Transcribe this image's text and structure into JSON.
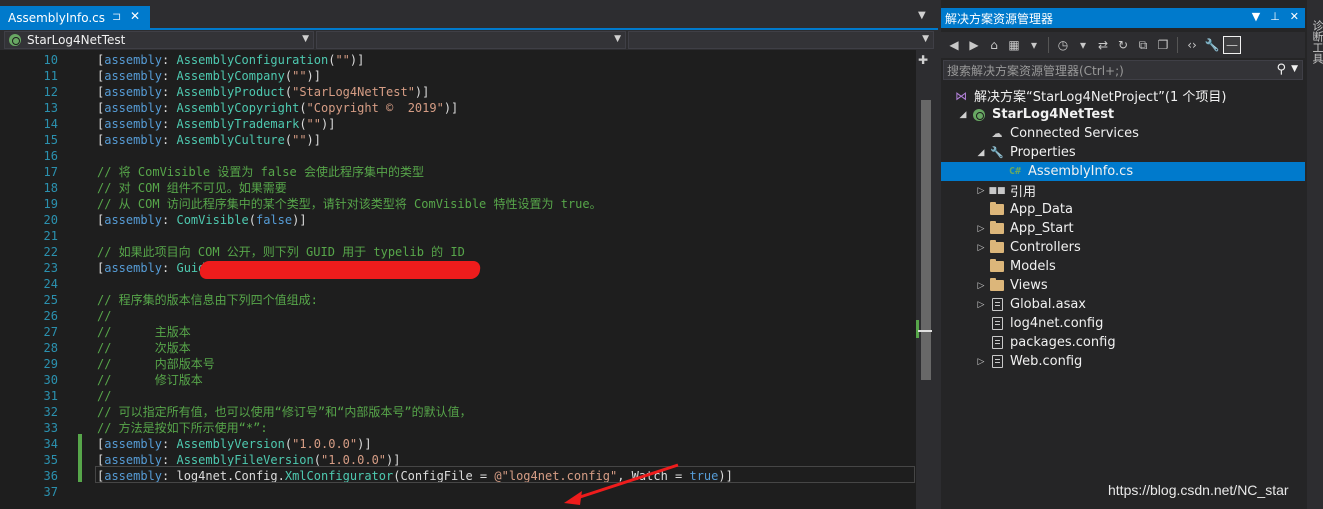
{
  "editor": {
    "tab": {
      "title": "AssemblyInfo.cs",
      "pin_icon": "pin-icon",
      "close_icon": "close-icon"
    },
    "nav": {
      "project": "StarLog4NetTest",
      "member1": "",
      "member2": ""
    },
    "lines": [
      {
        "n": "10",
        "parts": [
          [
            "p",
            "["
          ],
          [
            "k",
            "assembly"
          ],
          [
            "p",
            ": "
          ],
          [
            "t",
            "AssemblyConfiguration"
          ],
          [
            "p",
            "("
          ],
          [
            "s",
            "\"\""
          ],
          [
            "p",
            ")]"
          ]
        ]
      },
      {
        "n": "11",
        "parts": [
          [
            "p",
            "["
          ],
          [
            "k",
            "assembly"
          ],
          [
            "p",
            ": "
          ],
          [
            "t",
            "AssemblyCompany"
          ],
          [
            "p",
            "("
          ],
          [
            "s",
            "\"\""
          ],
          [
            "p",
            ")]"
          ]
        ]
      },
      {
        "n": "12",
        "parts": [
          [
            "p",
            "["
          ],
          [
            "k",
            "assembly"
          ],
          [
            "p",
            ": "
          ],
          [
            "t",
            "AssemblyProduct"
          ],
          [
            "p",
            "("
          ],
          [
            "s",
            "\"StarLog4NetTest\""
          ],
          [
            "p",
            ")]"
          ]
        ]
      },
      {
        "n": "13",
        "parts": [
          [
            "p",
            "["
          ],
          [
            "k",
            "assembly"
          ],
          [
            "p",
            ": "
          ],
          [
            "t",
            "AssemblyCopyright"
          ],
          [
            "p",
            "("
          ],
          [
            "s",
            "\"Copyright ©  2019\""
          ],
          [
            "p",
            ")]"
          ]
        ]
      },
      {
        "n": "14",
        "parts": [
          [
            "p",
            "["
          ],
          [
            "k",
            "assembly"
          ],
          [
            "p",
            ": "
          ],
          [
            "t",
            "AssemblyTrademark"
          ],
          [
            "p",
            "("
          ],
          [
            "s",
            "\"\""
          ],
          [
            "p",
            ")]"
          ]
        ]
      },
      {
        "n": "15",
        "parts": [
          [
            "p",
            "["
          ],
          [
            "k",
            "assembly"
          ],
          [
            "p",
            ": "
          ],
          [
            "t",
            "AssemblyCulture"
          ],
          [
            "p",
            "("
          ],
          [
            "s",
            "\"\""
          ],
          [
            "p",
            ")]"
          ]
        ]
      },
      {
        "n": "16",
        "parts": []
      },
      {
        "n": "17",
        "parts": [
          [
            "c",
            "// 将 ComVisible 设置为 false 会使此程序集中的类型"
          ]
        ]
      },
      {
        "n": "18",
        "parts": [
          [
            "c",
            "// 对 COM 组件不可见。如果需要"
          ]
        ]
      },
      {
        "n": "19",
        "parts": [
          [
            "c",
            "// 从 COM 访问此程序集中的某个类型，请针对该类型将 ComVisible 特性设置为 true。"
          ]
        ]
      },
      {
        "n": "20",
        "parts": [
          [
            "p",
            "["
          ],
          [
            "k",
            "assembly"
          ],
          [
            "p",
            ": "
          ],
          [
            "t",
            "ComVisible"
          ],
          [
            "p",
            "("
          ],
          [
            "k",
            "false"
          ],
          [
            "p",
            ")]"
          ]
        ]
      },
      {
        "n": "21",
        "parts": []
      },
      {
        "n": "22",
        "parts": [
          [
            "c",
            "// 如果此项目向 COM 公开，则下列 GUID 用于 typelib 的 ID"
          ]
        ]
      },
      {
        "n": "23",
        "parts": [
          [
            "p",
            "["
          ],
          [
            "k",
            "assembly"
          ],
          [
            "p",
            ": "
          ],
          [
            "t",
            "Guid"
          ],
          [
            "p",
            "                                  )]"
          ]
        ]
      },
      {
        "n": "24",
        "parts": []
      },
      {
        "n": "25",
        "parts": [
          [
            "c",
            "// 程序集的版本信息由下列四个值组成:"
          ]
        ]
      },
      {
        "n": "26",
        "parts": [
          [
            "c",
            "//"
          ]
        ]
      },
      {
        "n": "27",
        "parts": [
          [
            "c",
            "//      主版本"
          ]
        ]
      },
      {
        "n": "28",
        "parts": [
          [
            "c",
            "//      次版本"
          ]
        ]
      },
      {
        "n": "29",
        "parts": [
          [
            "c",
            "//      内部版本号"
          ]
        ]
      },
      {
        "n": "30",
        "parts": [
          [
            "c",
            "//      修订版本"
          ]
        ]
      },
      {
        "n": "31",
        "parts": [
          [
            "c",
            "//"
          ]
        ]
      },
      {
        "n": "32",
        "parts": [
          [
            "c",
            "// 可以指定所有值，也可以使用“修订号”和“内部版本号”的默认值，"
          ]
        ]
      },
      {
        "n": "33",
        "parts": [
          [
            "c",
            "// 方法是按如下所示使用“*”:"
          ]
        ]
      },
      {
        "n": "34",
        "parts": [
          [
            "p",
            "["
          ],
          [
            "k",
            "assembly"
          ],
          [
            "p",
            ": "
          ],
          [
            "t",
            "AssemblyVersion"
          ],
          [
            "p",
            "("
          ],
          [
            "s",
            "\"1.0.0.0\""
          ],
          [
            "p",
            ")]"
          ]
        ]
      },
      {
        "n": "35",
        "parts": [
          [
            "p",
            "["
          ],
          [
            "k",
            "assembly"
          ],
          [
            "p",
            ": "
          ],
          [
            "t",
            "AssemblyFileVersion"
          ],
          [
            "p",
            "("
          ],
          [
            "s",
            "\"1.0.0.0\""
          ],
          [
            "p",
            ")]"
          ]
        ]
      },
      {
        "n": "36",
        "parts": [
          [
            "p",
            "["
          ],
          [
            "k",
            "assembly"
          ],
          [
            "p",
            ": log4net.Config."
          ],
          [
            "t",
            "XmlConfigurator"
          ],
          [
            "p",
            "(ConfigFile = "
          ],
          [
            "s",
            "@\"log4net.config\""
          ],
          [
            "p",
            ", Watch = "
          ],
          [
            "k",
            "true"
          ],
          [
            "p",
            ")]"
          ]
        ]
      },
      {
        "n": "37",
        "parts": []
      }
    ]
  },
  "solution_explorer": {
    "title": "解决方案资源管理器",
    "search_placeholder": "搜索解决方案资源管理器(Ctrl+;)",
    "tree": [
      {
        "label": "解决方案“StarLog4NetProject”(1 个项目)",
        "icon": "solution-icon",
        "indent": 0,
        "exp": "",
        "selected": false
      },
      {
        "label": "StarLog4NetTest",
        "icon": "web-project-icon",
        "indent": 1,
        "exp": "expanded",
        "selected": false,
        "bold": true
      },
      {
        "label": "Connected Services",
        "icon": "connected-services-icon",
        "indent": 2,
        "exp": "",
        "selected": false
      },
      {
        "label": "Properties",
        "icon": "wrench-icon",
        "indent": 2,
        "exp": "expanded",
        "selected": false
      },
      {
        "label": "AssemblyInfo.cs",
        "icon": "csharp-file-icon",
        "indent": 3,
        "exp": "",
        "selected": true
      },
      {
        "label": "引用",
        "icon": "references-icon",
        "indent": 2,
        "exp": "collapsed",
        "selected": false
      },
      {
        "label": "App_Data",
        "icon": "folder-icon",
        "indent": 2,
        "exp": "",
        "selected": false
      },
      {
        "label": "App_Start",
        "icon": "folder-icon",
        "indent": 2,
        "exp": "collapsed",
        "selected": false
      },
      {
        "label": "Controllers",
        "icon": "folder-icon",
        "indent": 2,
        "exp": "collapsed",
        "selected": false
      },
      {
        "label": "Models",
        "icon": "folder-icon",
        "indent": 2,
        "exp": "",
        "selected": false
      },
      {
        "label": "Views",
        "icon": "folder-icon",
        "indent": 2,
        "exp": "collapsed",
        "selected": false
      },
      {
        "label": "Global.asax",
        "icon": "config-file-icon",
        "indent": 2,
        "exp": "collapsed",
        "selected": false
      },
      {
        "label": "log4net.config",
        "icon": "config-file-icon",
        "indent": 2,
        "exp": "",
        "selected": false
      },
      {
        "label": "packages.config",
        "icon": "config-file-icon",
        "indent": 2,
        "exp": "",
        "selected": false
      },
      {
        "label": "Web.config",
        "icon": "config-file-icon",
        "indent": 2,
        "exp": "collapsed",
        "selected": false
      }
    ]
  },
  "side_strip_label": "诊断工具",
  "watermark": "https://blog.csdn.net/NC_star",
  "colors": {
    "accent": "#007acc",
    "keyword": "#569cd6",
    "type": "#4ec9b0",
    "string": "#d69d85",
    "comment": "#57a64a",
    "line_number": "#2b91af",
    "annotation": "#ee1c1c"
  }
}
